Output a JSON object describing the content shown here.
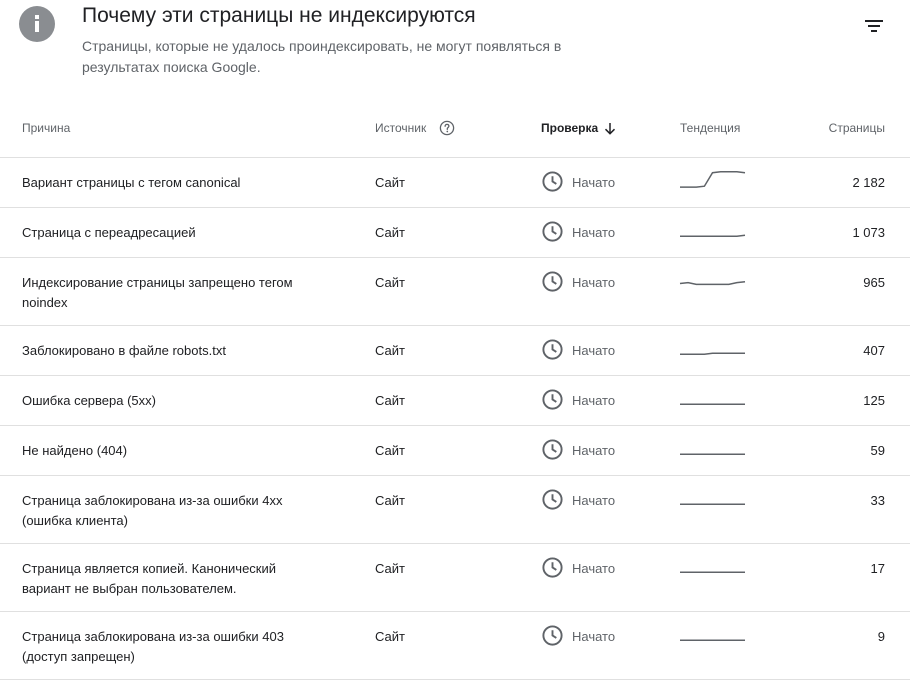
{
  "header": {
    "title": "Почему эти страницы не индексируются",
    "subtitle": "Страницы, которые не удалось проиндексировать, не могут появляться в результатах поиска Google.",
    "info_icon": "info-icon",
    "filter_icon": "filter-icon"
  },
  "table": {
    "columns": {
      "reason": "Причина",
      "source": "Источник",
      "check": "Проверка",
      "trend": "Тенденция",
      "pages": "Страницы"
    },
    "rows": [
      {
        "reason": "Вариант страницы с тегом canonical",
        "source": "Сайт",
        "status": "Начато",
        "pages": "2 182",
        "trend": [
          0.05,
          0.05,
          0.05,
          0.1,
          0.85,
          0.9,
          0.9,
          0.9,
          0.85
        ]
      },
      {
        "reason": "Страница с переадресацией",
        "source": "Сайт",
        "status": "Начато",
        "pages": "1 073",
        "trend": [
          0.1,
          0.1,
          0.1,
          0.1,
          0.1,
          0.1,
          0.1,
          0.1,
          0.15
        ]
      },
      {
        "reason": "Индексирование страницы запрещено тегом noindex",
        "source": "Сайт",
        "status": "Начато",
        "pages": "965",
        "trend": [
          0.25,
          0.3,
          0.2,
          0.2,
          0.2,
          0.2,
          0.2,
          0.3,
          0.35
        ]
      },
      {
        "reason": "Заблокировано в файле robots.txt",
        "source": "Сайт",
        "status": "Начато",
        "pages": "407",
        "trend": [
          0.1,
          0.1,
          0.1,
          0.1,
          0.15,
          0.15,
          0.15,
          0.15,
          0.15
        ]
      },
      {
        "reason": "Ошибка сервера (5xx)",
        "source": "Сайт",
        "status": "Начато",
        "pages": "125",
        "trend": [
          0.1,
          0.1,
          0.1,
          0.1,
          0.1,
          0.1,
          0.1,
          0.1,
          0.1
        ]
      },
      {
        "reason": "Не найдено (404)",
        "source": "Сайт",
        "status": "Начато",
        "pages": "59",
        "trend": [
          0.1,
          0.1,
          0.1,
          0.1,
          0.1,
          0.1,
          0.1,
          0.1,
          0.1
        ]
      },
      {
        "reason": "Страница заблокирована из-за ошибки 4xx (ошибка клиента)",
        "source": "Сайт",
        "status": "Начато",
        "pages": "33",
        "trend": [
          0.1,
          0.1,
          0.1,
          0.1,
          0.1,
          0.1,
          0.1,
          0.1,
          0.1
        ]
      },
      {
        "reason": "Страница является копией. Канонический вариант не выбран пользователем.",
        "source": "Сайт",
        "status": "Начато",
        "pages": "17",
        "trend": [
          0.1,
          0.1,
          0.1,
          0.1,
          0.1,
          0.1,
          0.1,
          0.1,
          0.1
        ]
      },
      {
        "reason": "Страница заблокирована из-за ошибки 403 (доступ запрещен)",
        "source": "Сайт",
        "status": "Начато",
        "pages": "9",
        "trend": [
          0.1,
          0.1,
          0.1,
          0.1,
          0.1,
          0.1,
          0.1,
          0.1,
          0.1
        ]
      }
    ]
  },
  "colors": {
    "text": "#202124",
    "secondary": "#5f6368",
    "icon_gray": "#8a8d91",
    "divider": "#e0e0e0",
    "sparkline": "#5f6368"
  }
}
